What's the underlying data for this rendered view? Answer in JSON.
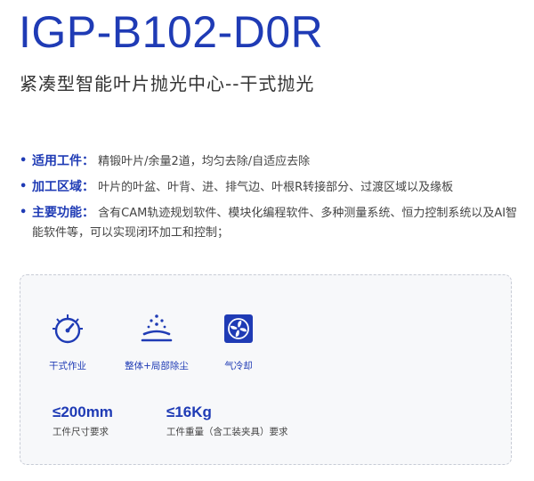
{
  "header": {
    "model": "IGP-B102-D0R",
    "subtitle": "紧凑型智能叶片抛光中心--干式抛光"
  },
  "features": [
    {
      "bullet": "•",
      "key": "适用工件：",
      "value": "精锻叶片/余量2道，均匀去除/自适应去除"
    },
    {
      "bullet": "•",
      "key": "加工区域：",
      "value": "叶片的叶盆、叶背、进、排气边、叶根R转接部分、过渡区域以及缘板"
    },
    {
      "bullet": "•",
      "key": "主要功能：",
      "value": "含有CAM轨迹规划软件、模块化编程软件、多种测量系统、恒力控制系统以及AI智能软件等，可以实现闭环加工和控制；"
    }
  ],
  "card": {
    "icons": [
      {
        "icon": "dial-gauge-icon",
        "label": "干式作业"
      },
      {
        "icon": "dust-removal-icon",
        "label": "整体+局部除尘"
      },
      {
        "icon": "fan-cooling-icon",
        "label": "气冷却"
      }
    ],
    "specs": [
      {
        "value": "≤200mm",
        "caption": "工件尺寸要求"
      },
      {
        "value": "≤16Kg",
        "caption": "工件重量（含工装夹具）要求"
      }
    ]
  },
  "colors": {
    "brand_blue": "#1f3bb5",
    "card_bg": "#f7f8fa",
    "card_border": "#c8ccd6"
  }
}
